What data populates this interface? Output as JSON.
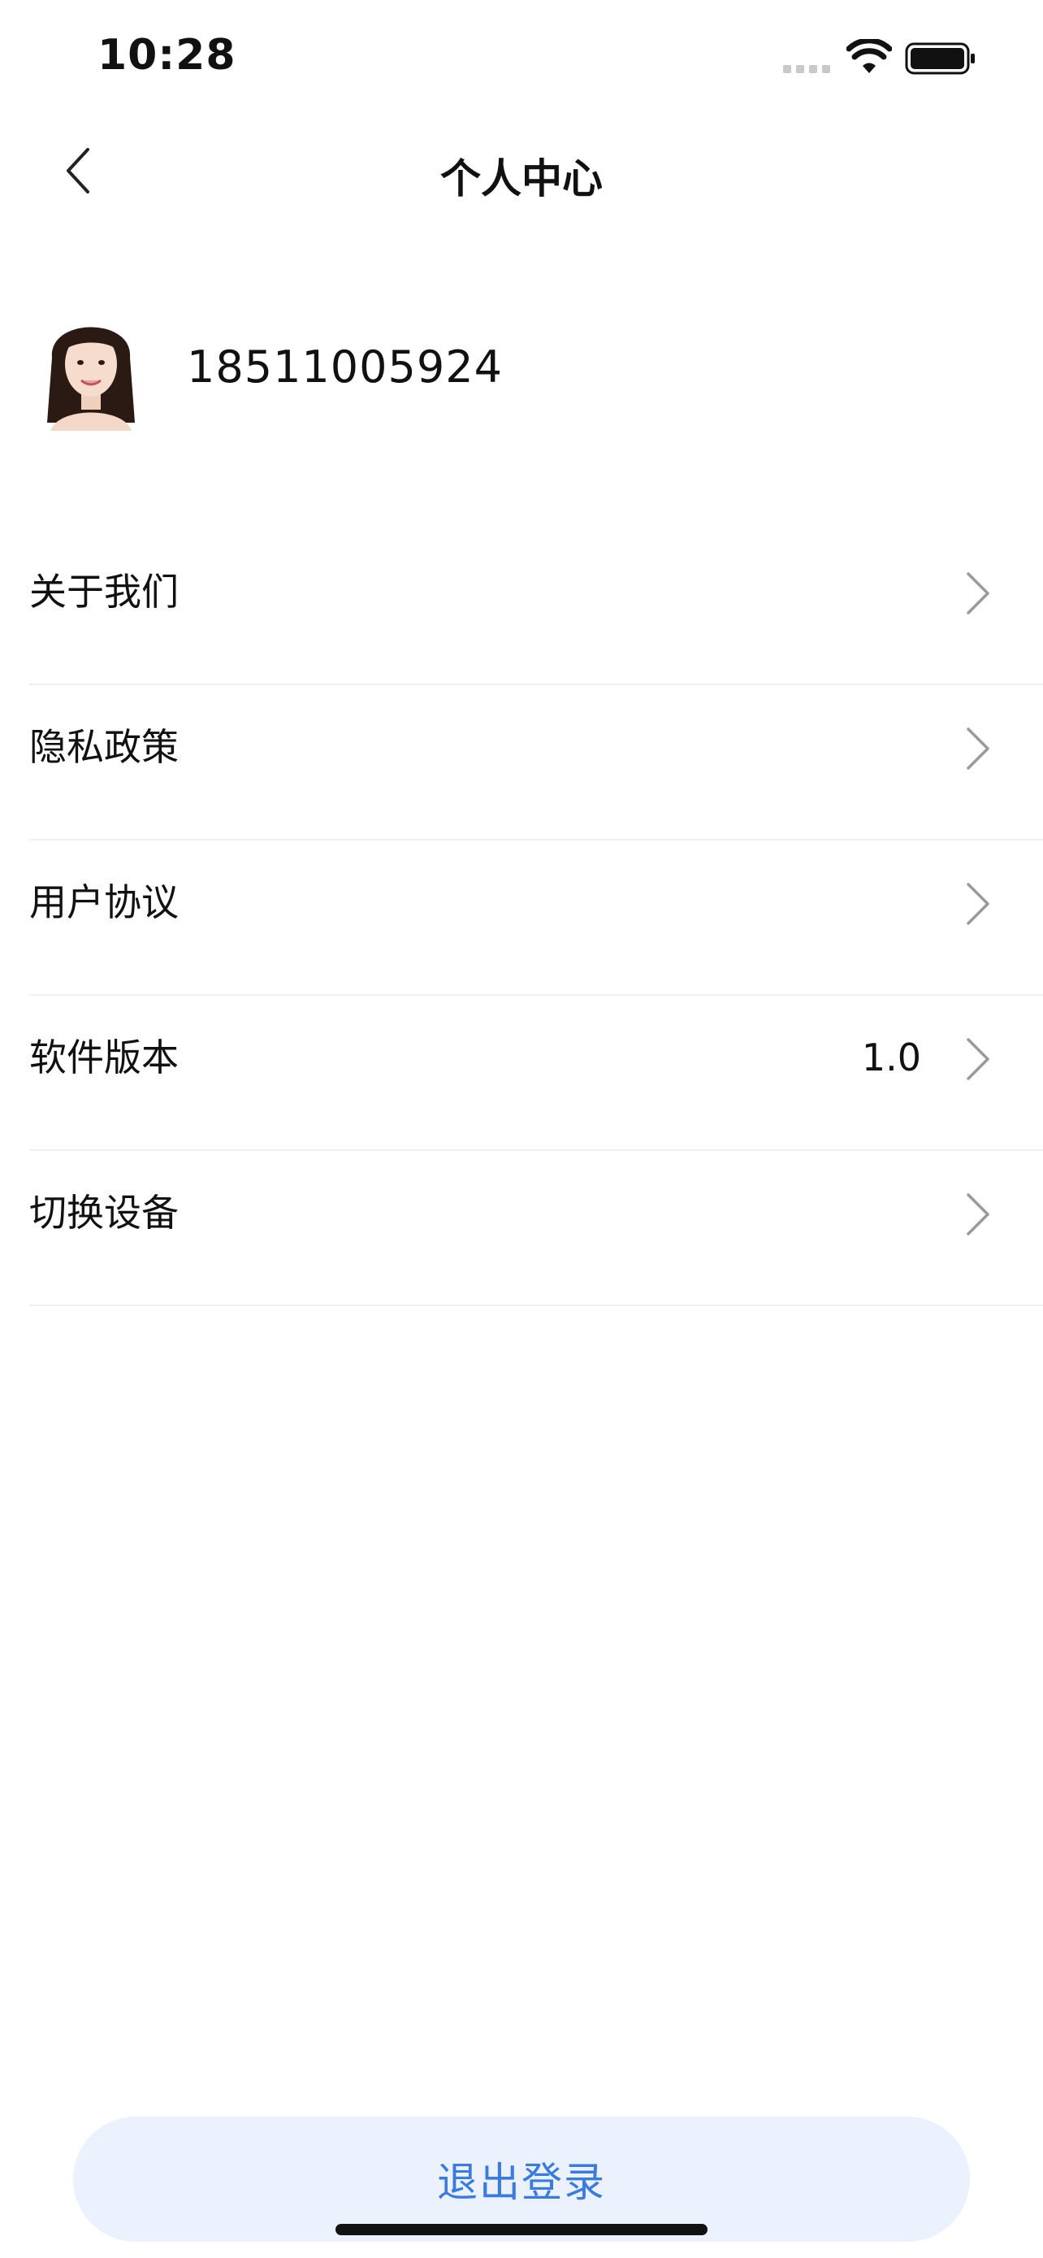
{
  "status_bar": {
    "time": "10:28"
  },
  "header": {
    "title": "个人中心"
  },
  "profile": {
    "phone": "18511005924"
  },
  "menu": [
    {
      "label": "关于我们",
      "value": ""
    },
    {
      "label": "隐私政策",
      "value": ""
    },
    {
      "label": "用户协议",
      "value": ""
    },
    {
      "label": "软件版本",
      "value": "1.0"
    },
    {
      "label": "切换设备",
      "value": ""
    }
  ],
  "logout": {
    "label": "退出登录"
  },
  "colors": {
    "accent": "#3a7be0",
    "logout_bg": "#ebf2fd",
    "divider": "#f0f0f0"
  },
  "icons": {
    "back": "chevron-left-icon",
    "row_arrow": "chevron-right-icon",
    "wifi": "wifi-icon",
    "battery": "battery-icon",
    "signal": "signal-icon"
  }
}
